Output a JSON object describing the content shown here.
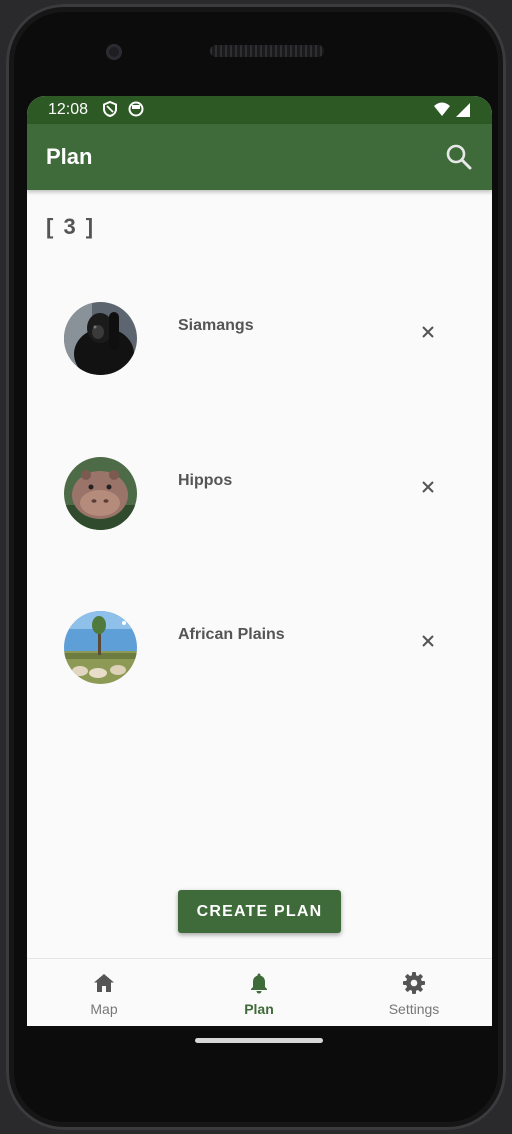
{
  "status_bar": {
    "time": "12:08"
  },
  "app_bar": {
    "title": "Plan"
  },
  "plan": {
    "count_label": "[ 3 ]",
    "items": [
      {
        "label": "Siamangs"
      },
      {
        "label": "Hippos"
      },
      {
        "label": "African Plains"
      }
    ]
  },
  "actions": {
    "create_label": "CREATE PLAN"
  },
  "bottom_nav": {
    "items": [
      {
        "label": "Map",
        "icon": "home-icon"
      },
      {
        "label": "Plan",
        "icon": "bell-icon",
        "active": true
      },
      {
        "label": "Settings",
        "icon": "gear-icon"
      }
    ]
  },
  "colors": {
    "primary": "#3e6b39",
    "status_bar": "#2d5a24",
    "text": "#555555"
  }
}
